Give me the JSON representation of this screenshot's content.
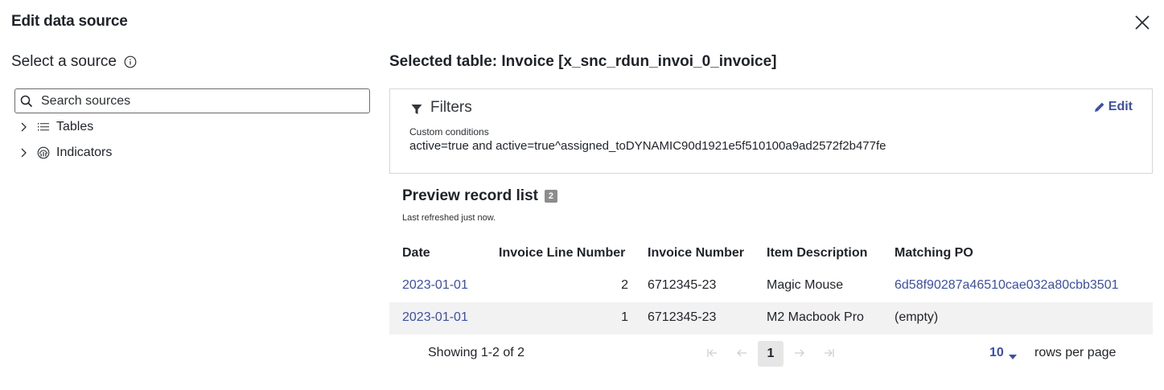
{
  "modal": {
    "title": "Edit data source"
  },
  "left": {
    "heading": "Select a source",
    "search": {
      "placeholder": "Search sources",
      "value": ""
    },
    "tree": [
      {
        "label": "Tables",
        "icon": "list-icon"
      },
      {
        "label": "Indicators",
        "icon": "indicator-icon"
      }
    ]
  },
  "right": {
    "selected_table": "Selected table: Invoice [x_snc_rdun_invoi_0_invoice]",
    "filters": {
      "title": "Filters",
      "edit_label": "Edit",
      "conditions_label": "Custom conditions",
      "conditions_value": "active=true and active=true^assigned_toDYNAMIC90d1921e5f510100a9ad2572f2b477fe"
    },
    "preview": {
      "title": "Preview record list",
      "count": "2",
      "refreshed": "Last refreshed just now.",
      "columns": [
        "Date",
        "Invoice Line Number",
        "Invoice Number",
        "Item Description",
        "Matching PO"
      ],
      "rows": [
        {
          "date": "2023-01-01",
          "line": "2",
          "invoice": "6712345-23",
          "item": "Magic Mouse",
          "po": "6d58f90287a46510cae032a80cbb3501"
        },
        {
          "date": "2023-01-01",
          "line": "1",
          "invoice": "6712345-23",
          "item": "M2 Macbook Pro",
          "po": "(empty)"
        }
      ]
    },
    "pagination": {
      "showing": "Showing 1-2 of 2",
      "current_page": "1",
      "rows_per_page": "10",
      "rows_per_page_label": "rows per page"
    }
  },
  "colors": {
    "accent": "#3b4fa8",
    "row_alt": "#f2f2f2",
    "border": "#d6d6d6"
  }
}
